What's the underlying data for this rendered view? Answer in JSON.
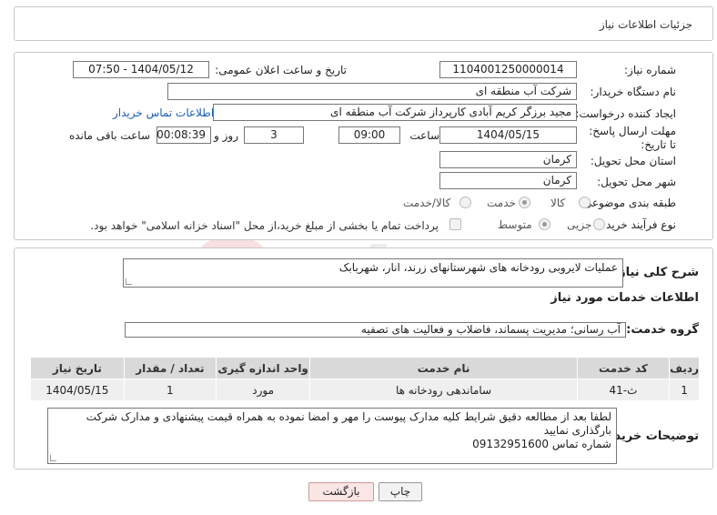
{
  "header": {
    "title": "جزئیات اطلاعات نیاز"
  },
  "form": {
    "need_number_label": "شماره نیاز:",
    "need_number": "1104001250000014",
    "announce_label": "تاریخ و ساعت اعلان عمومی:",
    "announce_value": "1404/05/12 - 07:50",
    "buyer_org_label": "نام دستگاه خریدار:",
    "buyer_org": "شرکت آب منطقه ای",
    "requester_label": "ایجاد کننده درخواست:",
    "requester": "مجید  برزگر کریم آبادی کارپرداز شرکت آب منطقه ای",
    "buyer_contact_link": "اطلاعات تماس خریدار",
    "deadline_label": "مهلت ارسال پاسخ: تا تاریخ:",
    "deadline_date": "1404/05/15",
    "time_label": "ساعت",
    "deadline_time": "09:00",
    "days_value": "3",
    "days_label": "روز و",
    "remaining_time": "00:08:39",
    "remaining_label": "ساعت باقی مانده",
    "province_label": "استان محل تحویل:",
    "province": "کرمان",
    "city_label": "شهر محل تحویل:",
    "city": "کرمان",
    "category_label": "طبقه بندی موضوعی:",
    "category_options": [
      "کالا",
      "خدمت",
      "کالا/خدمت"
    ],
    "category_selected": "خدمت",
    "process_label": "نوع فرآیند خرید :",
    "process_options": [
      "جزیی",
      "متوسط"
    ],
    "process_selected": "متوسط",
    "payment_note": "پرداخت تمام یا بخشی از مبلغ خرید،از محل \"اسناد خزانه اسلامی\" خواهد بود."
  },
  "details": {
    "summary_label": "شرح کلی نیاز:",
    "summary": "عملیات لایروبی رودخانه های شهرستانهای زرند، انار، شهربابک",
    "services_heading": "اطلاعات خدمات مورد نیاز",
    "service_group_label": "گروه خدمت:",
    "service_group": "آب رسانی؛ مدیریت پسماند، فاضلاب و فعالیت های تصفیه",
    "table": {
      "headers": [
        "ردیف",
        "کد خدمت",
        "نام خدمت",
        "واحد اندازه گیری",
        "تعداد / مقدار",
        "تاریخ نیاز"
      ],
      "rows": [
        [
          "1",
          "ث-41",
          "ساماندهی رودخانه ها",
          "مورد",
          "1",
          "1404/05/15"
        ]
      ]
    },
    "buyer_notes_label": "توضیحات خریدار:",
    "buyer_notes_line1": "لطفا بعد از مطالعه دقیق شرایط کلیه مدارک پیوست را مهر و امضا نموده به همراه قیمت پیشنهادی و مدارک شرکت بارگذاری نمایید",
    "buyer_notes_line2": "شماره تماس 09132951600"
  },
  "actions": {
    "print": "چاپ",
    "back": "بازگشت"
  },
  "colors": {
    "link": "#1a5fb4",
    "table_header": "#d9d9d9",
    "table_cell": "#efefef",
    "back_button": "#fbe6e6"
  }
}
